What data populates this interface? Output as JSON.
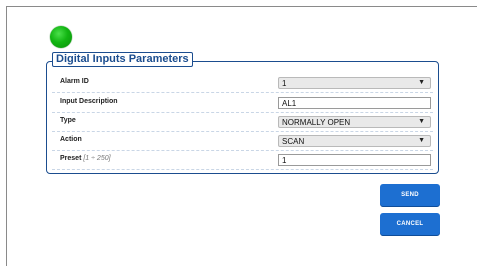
{
  "status_led": {
    "color": "#12b512"
  },
  "panel": {
    "title": "Digital Inputs Parameters",
    "rows": [
      {
        "label": "Alarm ID",
        "hint": "",
        "type": "select",
        "value": "1"
      },
      {
        "label": "Input Description",
        "hint": "",
        "type": "input",
        "value": "AL1"
      },
      {
        "label": "Type",
        "hint": "",
        "type": "select",
        "value": "NORMALLY OPEN"
      },
      {
        "label": "Action",
        "hint": "",
        "type": "select",
        "value": "SCAN"
      },
      {
        "label": "Preset",
        "hint": "[1 ÷ 250]",
        "type": "input",
        "value": "1"
      }
    ]
  },
  "buttons": {
    "send": "SEND",
    "cancel": "CANCEL"
  },
  "colors": {
    "accent": "#1d6fd1",
    "panel_border": "#1b4d8f"
  }
}
